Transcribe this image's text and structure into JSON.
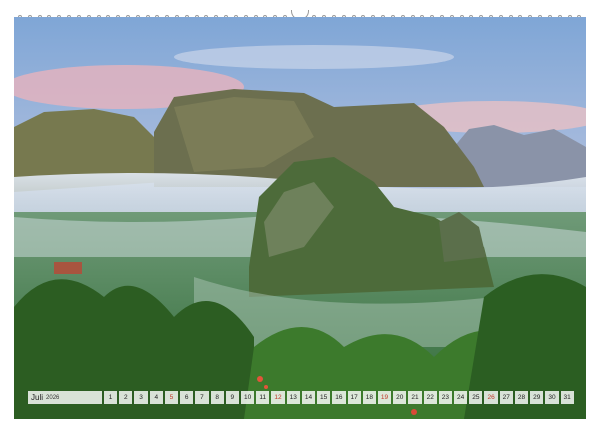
{
  "calendar": {
    "month": "Juli",
    "year": "2026",
    "days": [
      {
        "n": "1",
        "sunday": false
      },
      {
        "n": "2",
        "sunday": false
      },
      {
        "n": "3",
        "sunday": false
      },
      {
        "n": "4",
        "sunday": false
      },
      {
        "n": "5",
        "sunday": true
      },
      {
        "n": "6",
        "sunday": false
      },
      {
        "n": "7",
        "sunday": false
      },
      {
        "n": "8",
        "sunday": false
      },
      {
        "n": "9",
        "sunday": false
      },
      {
        "n": "10",
        "sunday": false
      },
      {
        "n": "11",
        "sunday": false
      },
      {
        "n": "12",
        "sunday": true
      },
      {
        "n": "13",
        "sunday": false
      },
      {
        "n": "14",
        "sunday": false
      },
      {
        "n": "15",
        "sunday": false
      },
      {
        "n": "16",
        "sunday": false
      },
      {
        "n": "17",
        "sunday": false
      },
      {
        "n": "18",
        "sunday": false
      },
      {
        "n": "19",
        "sunday": true
      },
      {
        "n": "20",
        "sunday": false
      },
      {
        "n": "21",
        "sunday": false
      },
      {
        "n": "22",
        "sunday": false
      },
      {
        "n": "23",
        "sunday": false
      },
      {
        "n": "24",
        "sunday": false
      },
      {
        "n": "25",
        "sunday": false
      },
      {
        "n": "26",
        "sunday": true
      },
      {
        "n": "27",
        "sunday": false
      },
      {
        "n": "28",
        "sunday": false
      },
      {
        "n": "29",
        "sunday": false
      },
      {
        "n": "30",
        "sunday": false
      },
      {
        "n": "31",
        "sunday": false
      }
    ]
  },
  "colors": {
    "sunday": "#c0392b",
    "weekday": "#222222"
  }
}
